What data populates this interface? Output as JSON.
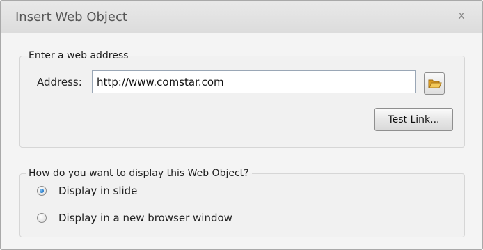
{
  "dialog": {
    "title": "Insert Web Object",
    "close_glyph": "x"
  },
  "web_address_group": {
    "legend": "Enter a web address",
    "address_label": "Address:",
    "address_value": "http://www.comstar.com",
    "browse_icon": "folder-open-icon",
    "test_link_label": "Test Link..."
  },
  "display_group": {
    "legend": "How do you want to display this Web Object?",
    "options": [
      {
        "label": "Display in slide",
        "selected": true
      },
      {
        "label": "Display in a new browser window",
        "selected": false
      }
    ]
  },
  "colors": {
    "radio_selected": "#2a7fcf",
    "folder_icon": "#e8b43a"
  }
}
